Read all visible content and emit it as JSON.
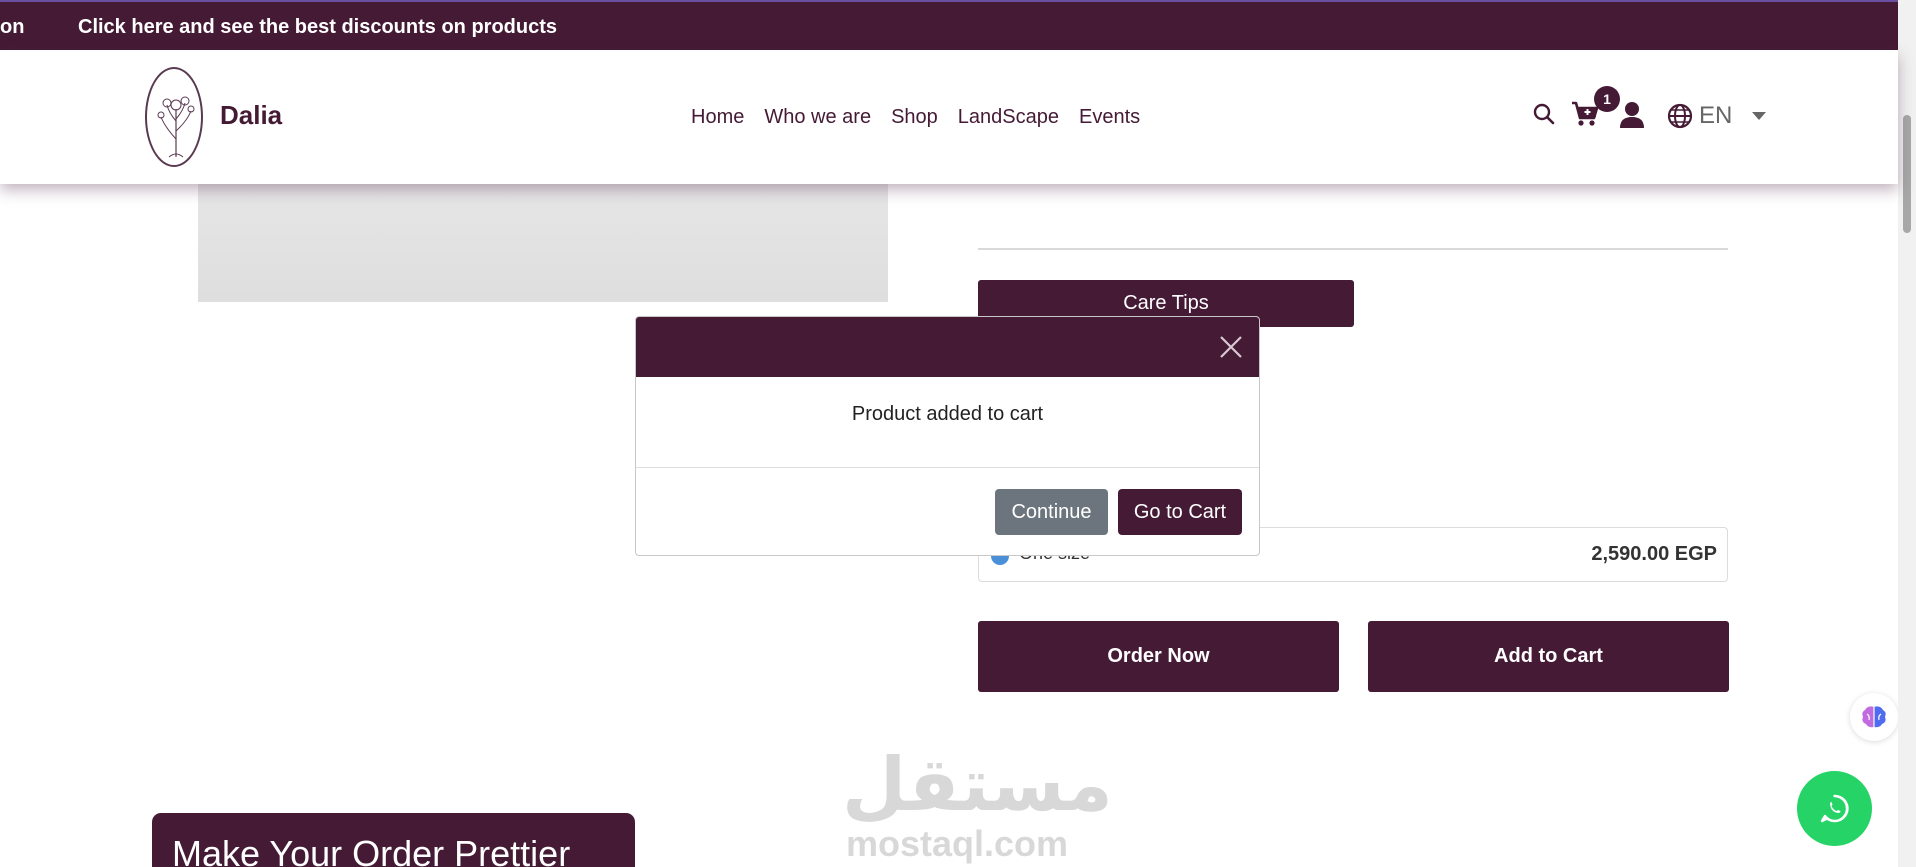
{
  "promo": {
    "text_partial": "on",
    "text": "Click here and see the best discounts on products"
  },
  "header": {
    "brand": "Dalia",
    "nav": [
      "Home",
      "Who we are",
      "Shop",
      "LandScape",
      "Events"
    ],
    "cart_count": "1",
    "language": "EN",
    "icons": [
      "search-icon",
      "cart-icon",
      "user-icon",
      "globe-icon",
      "caret-down-icon"
    ]
  },
  "product": {
    "care_tips_label": "Care Tips",
    "size_label": "One size",
    "price": "2,590.00 EGP",
    "order_now_label": "Order Now",
    "add_to_cart_label": "Add to Cart"
  },
  "modal": {
    "message": "Product added to cart",
    "continue_label": "Continue",
    "go_to_cart_label": "Go to Cart"
  },
  "section": {
    "title": "Make Your Order Prettier"
  },
  "watermark": {
    "arabic": "مستقل",
    "latin": "mostaql.com"
  },
  "colors": {
    "brand": "#441a35",
    "whatsapp": "#25d366",
    "continue": "#6c757d"
  }
}
